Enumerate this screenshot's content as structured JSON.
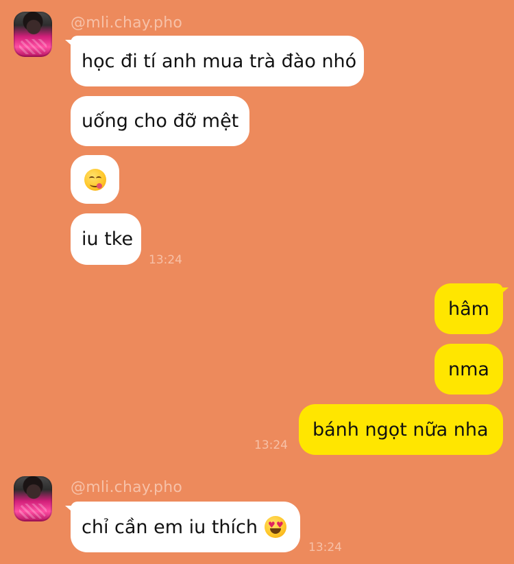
{
  "theme": {
    "background": "#ed8a5c",
    "incoming_bubble": "#ffffff",
    "outgoing_bubble": "#ffe600",
    "meta_text": "#f7c1a8"
  },
  "groups": [
    {
      "sender": "@mli.chay.pho",
      "messages": [
        "học đi tí anh mua trà đào nhó",
        "uống cho đỡ mệt",
        "iu tke"
      ],
      "emoji_message_icon": "face-savoring-food-icon",
      "time": "13:24"
    },
    {
      "messages": [
        "hâm",
        "nma",
        "bánh ngọt nữa nha"
      ],
      "time": "13:24"
    },
    {
      "sender": "@mli.chay.pho",
      "messages": [
        "chỉ cần em iu thích"
      ],
      "emoji_icon": "smiling-face-with-heart-eyes-icon",
      "time": "13:24"
    }
  ]
}
